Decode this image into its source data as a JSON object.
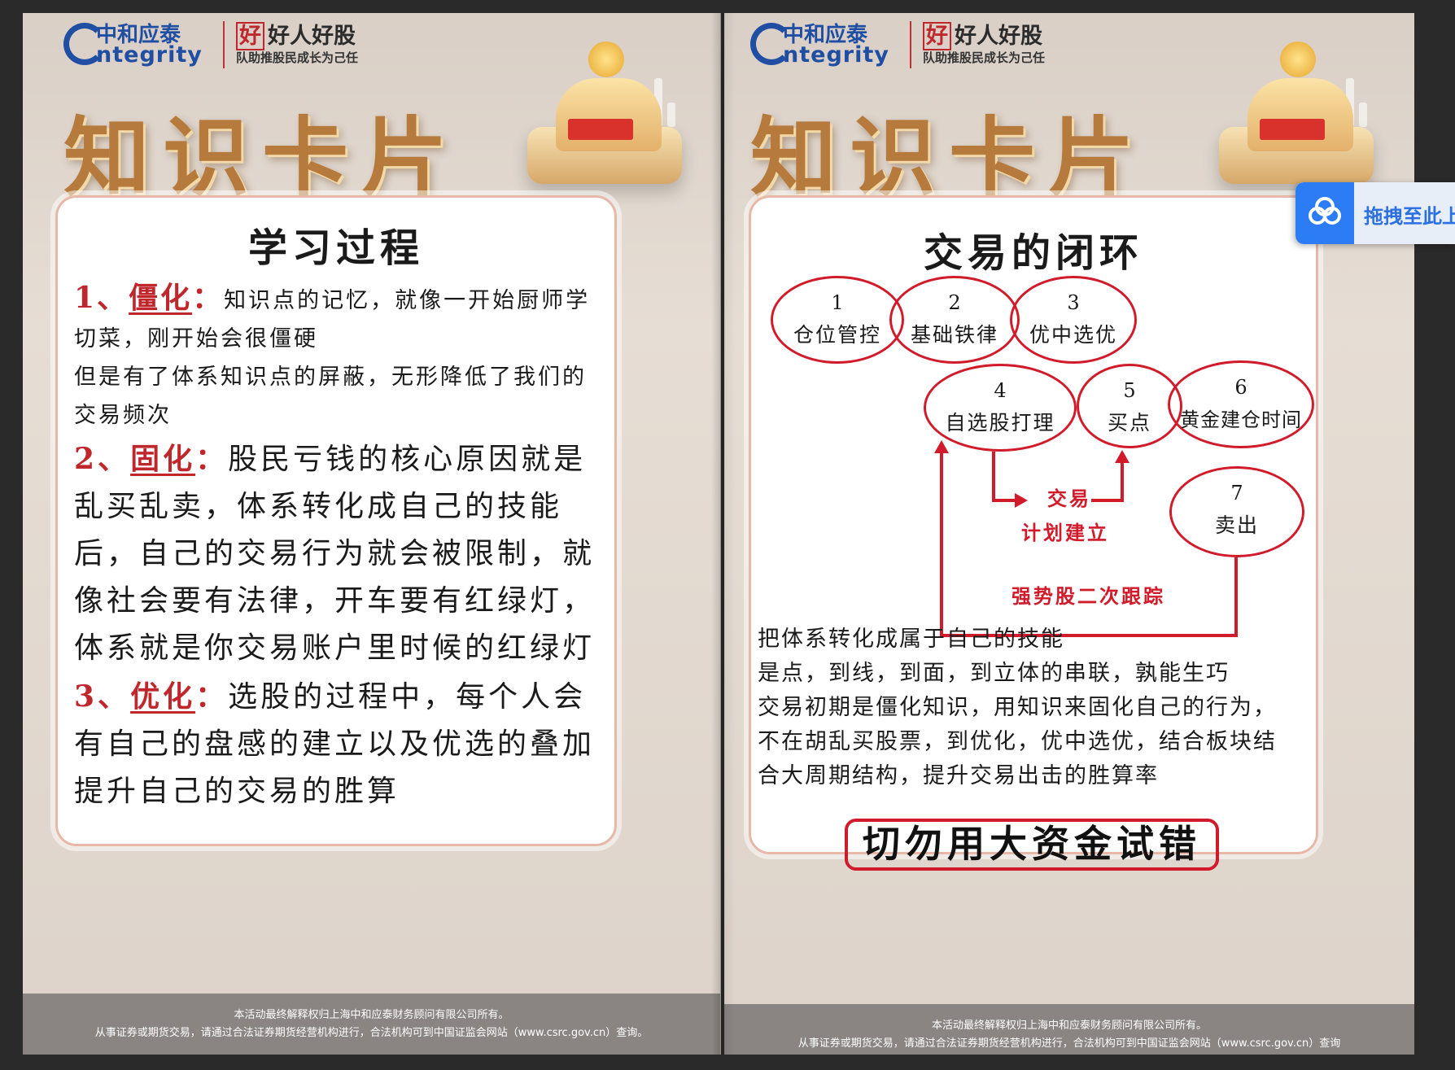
{
  "left_page": {
    "logo": {
      "cn": "中和应泰",
      "en": "ntegrity",
      "slogan_mark": "好",
      "slogan": "好人好股",
      "sub": "队助推股民成长为己任"
    },
    "big_title": "知识卡片",
    "card": {
      "title": "学习过程",
      "p1_num": "1、",
      "p1_key": "僵化",
      "p1_colon": "：",
      "p1_text": "知识点的记忆，就像一开始厨师学切菜，刚开始会很僵硬",
      "p1_text2": "但是有了体系知识点的屏蔽，无形降低了我们的交易频次",
      "p2_num": "2、",
      "p2_key": "固化",
      "p2_colon": "：",
      "p2_text": "股民亏钱的核心原因就是乱买乱卖，体系转化成自己的技能后，自己的交易行为就会被限制，就像社会要有法律，开车要有红绿灯，体系就是你交易账户里时候的红绿灯",
      "p3_num": "3、",
      "p3_key": "优化",
      "p3_colon": "：",
      "p3_text": "选股的过程中，每个人会有自己的盘感的建立以及优选的叠加提升自己的交易的胜算"
    },
    "footer": {
      "line1": "本活动最终解释权归上海中和应泰财务顾问有限公司所有。",
      "line2": "从事证券或期货交易，请通过合法证券期货经营机构进行，合法机构可到中国证监会网站（www.csrc.gov.cn）查询。"
    }
  },
  "right_page": {
    "logo": {
      "cn": "中和应泰",
      "en": "ntegrity",
      "slogan_mark": "好",
      "slogan": "好人好股",
      "sub": "队助推股民成长为己任"
    },
    "big_title": "知识卡片",
    "card": {
      "title": "交易的闭环",
      "nodes": [
        {
          "num": "1",
          "label": "仓位管控"
        },
        {
          "num": "2",
          "label": "基础铁律"
        },
        {
          "num": "3",
          "label": "优中选优"
        },
        {
          "num": "4",
          "label": "自选股打理"
        },
        {
          "num": "5",
          "label": "买点"
        },
        {
          "num": "6",
          "label": "黄金建仓时间"
        },
        {
          "num": "7",
          "label": "卖出"
        }
      ],
      "flow_label_1": "交易",
      "flow_label_2": "计划建立",
      "loop_label": "强势股二次跟踪",
      "text_lines": [
        "把体系转化成属于自己的技能",
        "是点，到线，到面，到立体的串联，孰能生巧",
        "交易初期是僵化知识，用知识来固化自己的行为，",
        "不在胡乱买股票，到优化，优中选优，结合板块结",
        "合大周期结构，提升交易出击的胜算率"
      ],
      "warning": "切勿用大资金试错"
    },
    "footer": {
      "line1": "本活动最终解释权归上海中和应泰财务顾问有限公司所有。",
      "line2": "从事证券或期货交易，请通过合法证券期货经营机构进行，合法机构可到中国证监会网站（www.csrc.gov.cn）查询"
    }
  },
  "floating_button": {
    "label": "拖拽至此上",
    "icon": "baidu-netdisk-icon"
  },
  "colors": {
    "accent_red": "#d11a2a",
    "title_gold": "#b57a3c",
    "brand_blue": "#1f4ea3",
    "float_blue": "#2c7cf6"
  }
}
